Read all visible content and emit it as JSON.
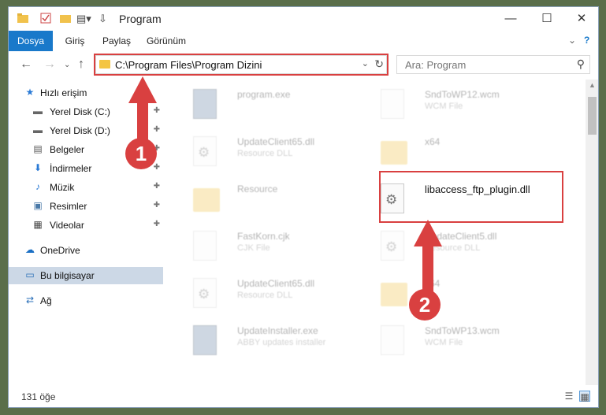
{
  "window": {
    "title": "Program",
    "controls": {
      "minimize": "—",
      "maximize": "☐",
      "close": "✕"
    }
  },
  "ribbon": {
    "tabs": [
      "Dosya",
      "Giriş",
      "Paylaş",
      "Görünüm"
    ],
    "expand_icon": "chevron-down-icon",
    "help_icon": "?"
  },
  "address": {
    "path": "C:\\Program Files\\Program Dizini",
    "refresh_icon": "↻",
    "dropdown_icon": "⌄"
  },
  "search": {
    "placeholder": "Ara: Program",
    "icon": "⚲"
  },
  "sidebar": {
    "items": [
      {
        "label": "Hızlı erişim",
        "icon": "★",
        "pinned": false
      },
      {
        "label": "Yerel Disk (C:)",
        "icon": "▬",
        "pinned": true
      },
      {
        "label": "Yerel Disk (D:)",
        "icon": "▬",
        "pinned": true
      },
      {
        "label": "Belgeler",
        "icon": "▤",
        "pinned": true
      },
      {
        "label": "İndirmeler",
        "icon": "⬇",
        "pinned": true
      },
      {
        "label": "Müzik",
        "icon": "♪",
        "pinned": true
      },
      {
        "label": "Resimler",
        "icon": "▣",
        "pinned": true
      },
      {
        "label": "Videolar",
        "icon": "▦",
        "pinned": true
      },
      {
        "label": "OneDrive",
        "icon": "☁",
        "pinned": false
      },
      {
        "label": "Bu bilgisayar",
        "icon": "▭",
        "pinned": false
      },
      {
        "label": "Ağ",
        "icon": "⇄",
        "pinned": false
      }
    ],
    "pin_glyph": "📌"
  },
  "files": {
    "left": [
      {
        "name": "program.exe",
        "type": ""
      },
      {
        "name": "UpdateClient65.dll",
        "type": "Resource DLL"
      },
      {
        "name": "Resource",
        "type": ""
      },
      {
        "name": "FastKorn.cjk",
        "type": "CJK File"
      },
      {
        "name": "UpdateClient65.dll",
        "type": "Resource DLL"
      },
      {
        "name": "UpdateInstaller.exe",
        "type": "ABBY updates installer"
      }
    ],
    "right": [
      {
        "name": "SndToWP12.wcm",
        "type": "WCM File"
      },
      {
        "name": "x64",
        "type": ""
      },
      {
        "name": "libaccess_ftp_plugin.dll",
        "type": ""
      },
      {
        "name": "UpdateClient5.dll",
        "type": "Resource DLL"
      },
      {
        "name": "x64",
        "type": ""
      },
      {
        "name": "SndToWP13.wcm",
        "type": "WCM File"
      }
    ]
  },
  "status": {
    "count": "131 öğe"
  },
  "annotations": {
    "step1": "1",
    "step2": "2",
    "color": "#d94040"
  }
}
